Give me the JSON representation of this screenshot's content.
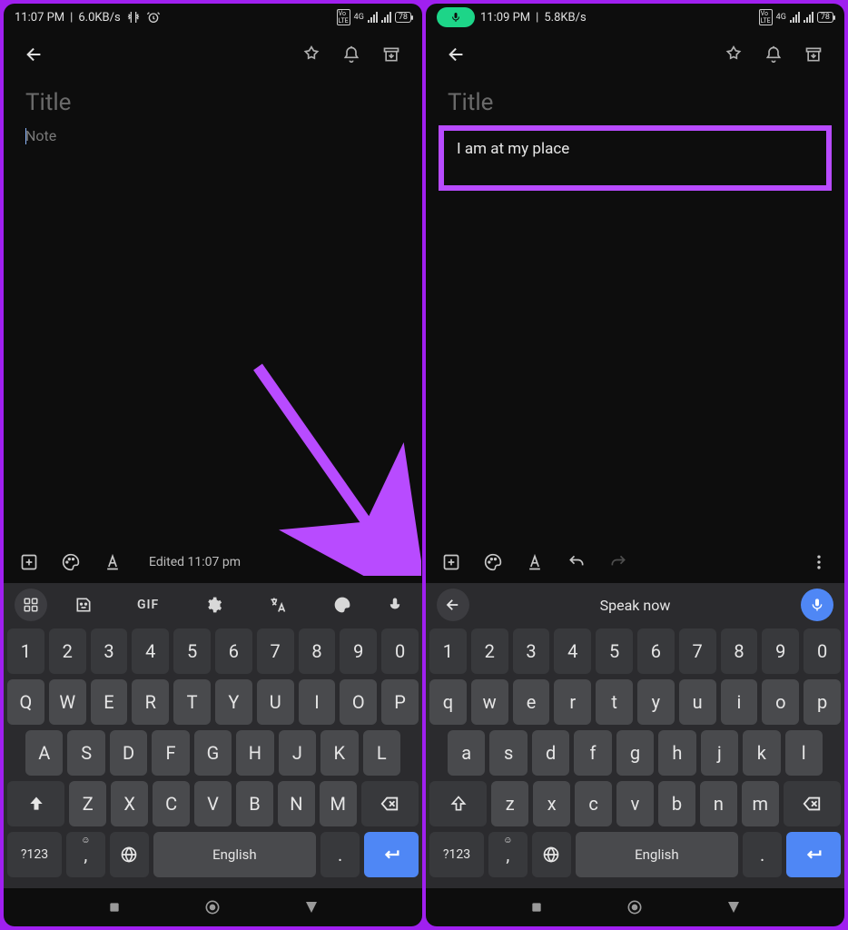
{
  "left": {
    "status": {
      "time": "11:07 PM",
      "speed": "6.0KB/s",
      "battery": "78",
      "net": "4G"
    },
    "title_placeholder": "Title",
    "note_placeholder": "Note",
    "edited": "Edited 11:07 pm",
    "kb": {
      "row_num": [
        "1",
        "2",
        "3",
        "4",
        "5",
        "6",
        "7",
        "8",
        "9",
        "0"
      ],
      "row1": [
        "Q",
        "W",
        "E",
        "R",
        "T",
        "Y",
        "U",
        "I",
        "O",
        "P"
      ],
      "row2": [
        "A",
        "S",
        "D",
        "F",
        "G",
        "H",
        "J",
        "K",
        "L"
      ],
      "row3": [
        "Z",
        "X",
        "C",
        "V",
        "B",
        "N",
        "M"
      ],
      "sym": "?123",
      "comma": ",",
      "space": "English",
      "period": ".",
      "gif": "GIF"
    }
  },
  "right": {
    "status": {
      "time": "11:09 PM",
      "speed": "5.8KB/s",
      "battery": "78",
      "net": "4G"
    },
    "title_placeholder": "Title",
    "note_text": "I am at my place",
    "speak_now": "Speak now",
    "kb": {
      "row_num": [
        "1",
        "2",
        "3",
        "4",
        "5",
        "6",
        "7",
        "8",
        "9",
        "0"
      ],
      "row1": [
        "q",
        "w",
        "e",
        "r",
        "t",
        "y",
        "u",
        "i",
        "o",
        "p"
      ],
      "row2": [
        "a",
        "s",
        "d",
        "f",
        "g",
        "h",
        "j",
        "k",
        "l"
      ],
      "row3": [
        "z",
        "x",
        "c",
        "v",
        "b",
        "n",
        "m"
      ],
      "sym": "?123",
      "comma": ",",
      "space": "English",
      "period": "."
    }
  }
}
